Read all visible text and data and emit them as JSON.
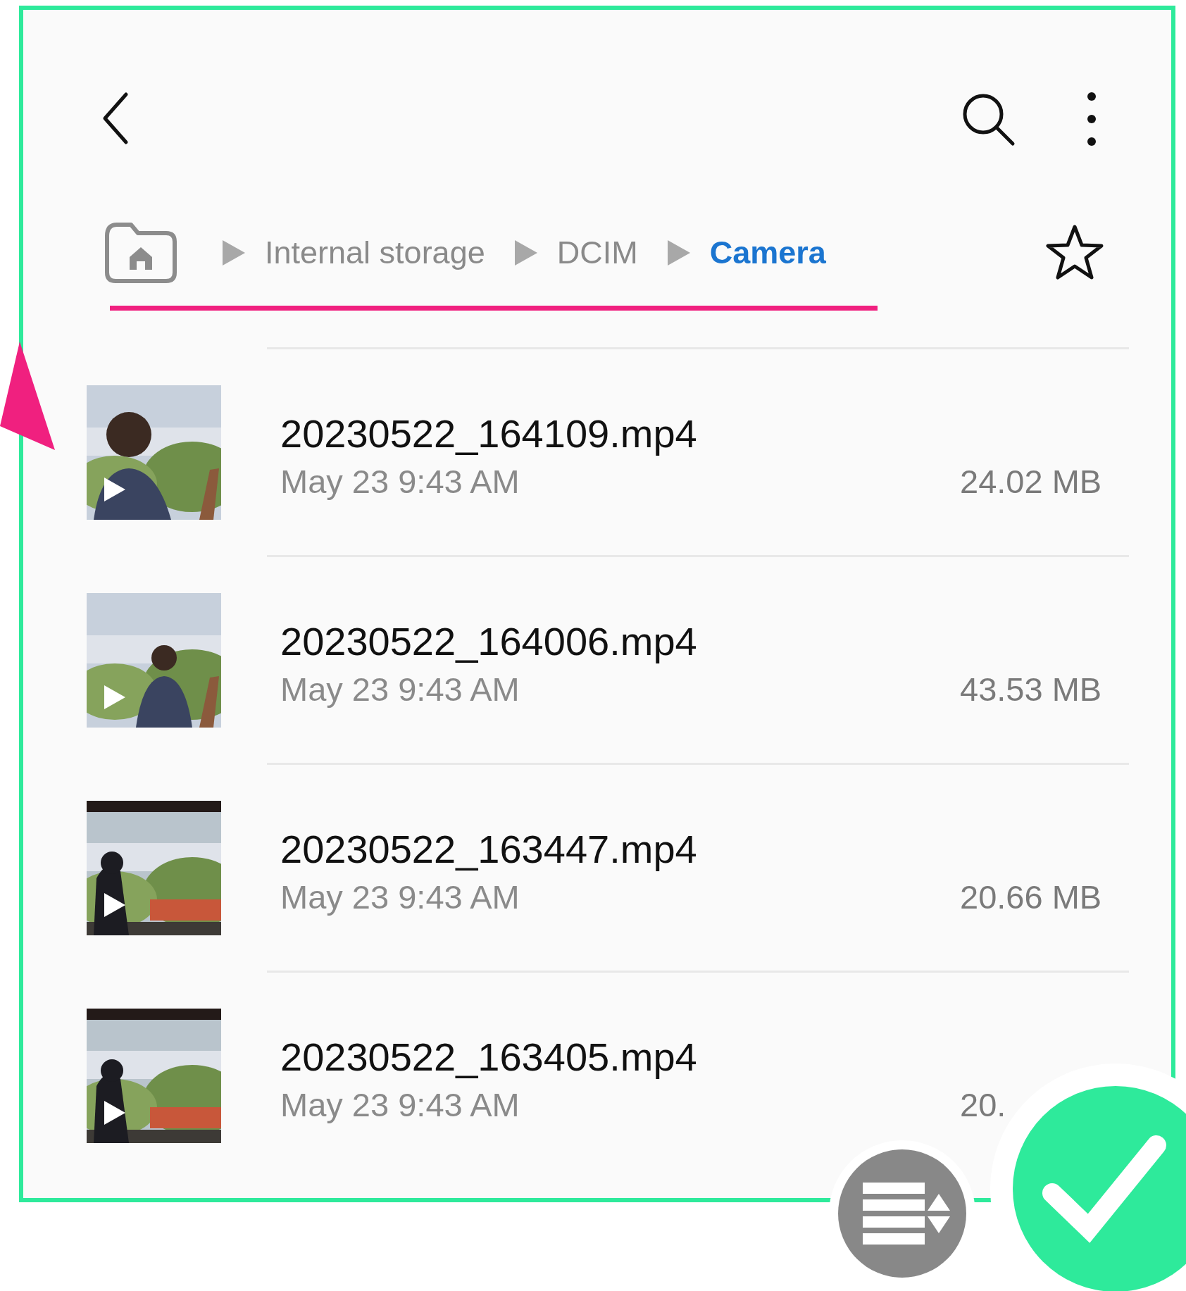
{
  "breadcrumb": [
    {
      "label": "Internal storage",
      "selected": false
    },
    {
      "label": "DCIM",
      "selected": false
    },
    {
      "label": "Camera",
      "selected": true
    }
  ],
  "favorite": false,
  "files": [
    {
      "name": "20230522_164109.mp4",
      "date": "May 23 9:43 AM",
      "size": "24.02 MB",
      "kind": "video"
    },
    {
      "name": "20230522_164006.mp4",
      "date": "May 23 9:43 AM",
      "size": "43.53 MB",
      "kind": "video"
    },
    {
      "name": "20230522_163447.mp4",
      "date": "May 23 9:43 AM",
      "size": "20.66 MB",
      "kind": "video"
    },
    {
      "name": "20230522_163405.mp4",
      "date": "May 23 9:43 AM",
      "size": "20.",
      "kind": "video"
    }
  ]
}
